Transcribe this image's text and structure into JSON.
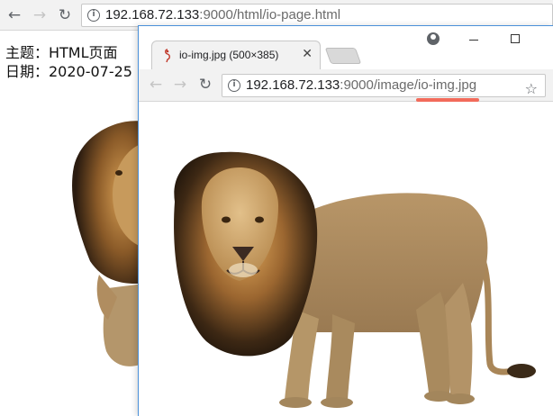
{
  "background_window": {
    "address_host": "192.168.72.133",
    "address_path": ":9000/html/io-page.html",
    "page_lines": [
      "主题：HTML页面",
      "日期：2020-07-25"
    ]
  },
  "foreground_window": {
    "tab_title": "io-img.jpg (500×385)",
    "address_host": "192.168.72.133",
    "address_path": ":9000/image/io-img.jpg",
    "image_subject": "lion"
  },
  "icons": {
    "back": "back-arrow-icon",
    "forward": "forward-arrow-icon",
    "reload": "reload-icon",
    "info": "info-icon",
    "star": "star-icon",
    "close": "close-icon",
    "profile": "profile-icon",
    "minimize": "minimize-icon",
    "maximize": "maximize-icon"
  },
  "colors": {
    "highlight_underline": "#f26b5b",
    "window_border": "#4a90d9"
  }
}
